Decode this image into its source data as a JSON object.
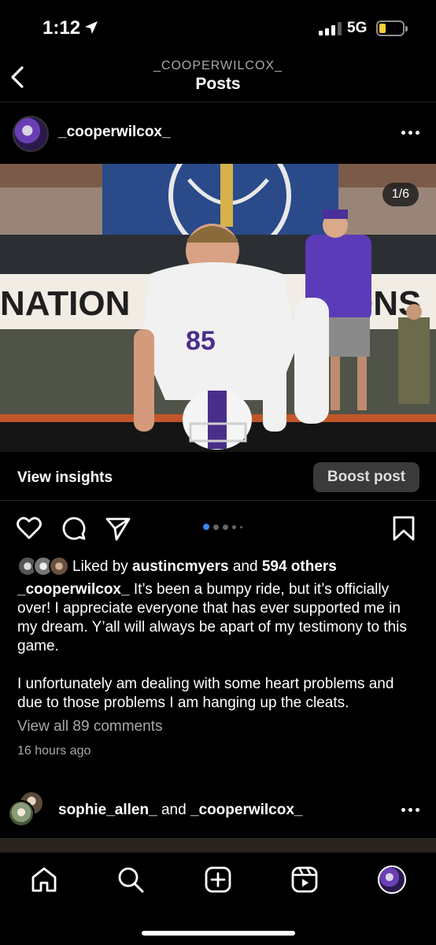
{
  "status_bar": {
    "time": "1:12",
    "network": "5G",
    "battery_color": "#f7ce3c"
  },
  "nav": {
    "subtitle": "_COOPERWILCOX_",
    "title": "Posts",
    "back_icon": "chevron-left-icon"
  },
  "post": {
    "username": "_cooperwilcox_",
    "photo_counter": "1/6",
    "insights_label": "View insights",
    "boost_label": "Boost post",
    "pager": {
      "current": 1,
      "visible_dots": 4
    },
    "likes": {
      "prefix": "Liked by ",
      "user": "austincmyers",
      "middle": " and ",
      "others": "594 others"
    },
    "caption_user": "_cooperwilcox_",
    "caption_p1": " It’s been a bumpy ride, but it’s officially over! I appreciate everyone that has ever supported me in my dream. Y’all will always be apart of my testimony to this game.",
    "caption_p2": "I unfortunately am dealing with some heart problems and due to those problems I am hanging up the cleats.",
    "comments_link": "View all 89 comments",
    "time_ago": "16 hours ago"
  },
  "next_post": {
    "user1": "sophie_allen_",
    "joiner": " and ",
    "user2": "_cooperwilcox_"
  },
  "tab_bar": {
    "items": [
      "home-icon",
      "search-icon",
      "create-icon",
      "reels-icon",
      "profile-avatar"
    ]
  }
}
